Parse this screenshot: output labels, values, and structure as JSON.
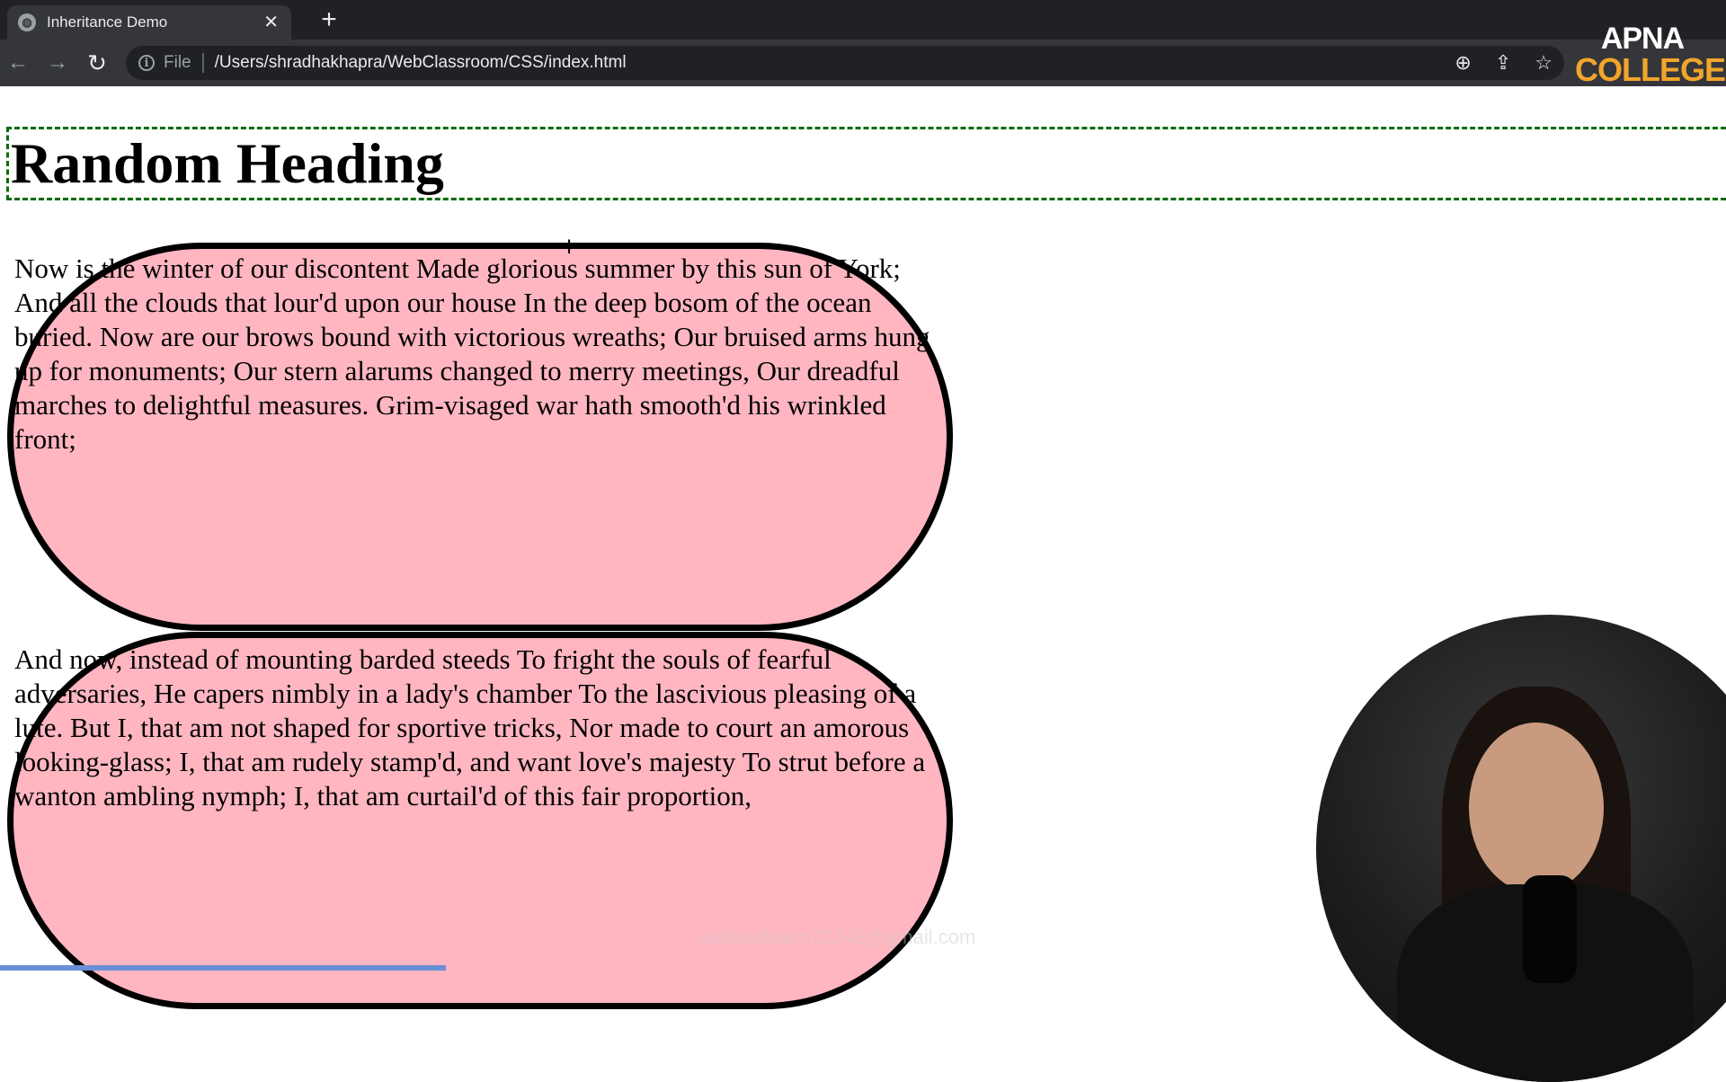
{
  "browser": {
    "tab_title": "Inheritance Demo",
    "tab_close": "✕",
    "new_tab": "+",
    "scheme_label": "File",
    "url": "/Users/shradhakhapra/WebClassroom/CSS/index.html",
    "nav_icons": {
      "back": "←",
      "forward": "→",
      "reload": "↻"
    },
    "toolbar_icons": {
      "zoom": "⊕",
      "share": "⇪",
      "bookmark": "☆"
    }
  },
  "logo": {
    "line1": "APNA",
    "line2": "COLLEGE"
  },
  "page": {
    "heading": "Random Heading",
    "paragraphs": [
      "Now is the winter of our discontent Made glorious summer by this sun of York; And all the clouds that lour'd upon our house In the deep bosom of the ocean buried. Now are our brows bound with victorious wreaths; Our bruised arms hung up for monuments; Our stern alarums changed to merry meetings, Our dreadful marches to delightful measures. Grim-visaged war hath smooth'd his wrinkled front;",
      "And now, instead of mounting barded steeds To fright the souls of fearful adversaries, He capers nimbly in a lady's chamber To the lascivious pleasing of a lute. But I, that am not shaped for sportive tricks, Nor made to court an amorous looking-glass; I, that am rudely stamp'd, and want love's majesty To strut before a wanton ambling nymph; I, that am curtail'd of this fair proportion,"
    ]
  },
  "watermark": "saitejadulam12345@gmail.com",
  "colors": {
    "pill_background": "#ffb6c1",
    "heading_border": "#0a6b0a",
    "logo_accent": "#f2a52b"
  }
}
